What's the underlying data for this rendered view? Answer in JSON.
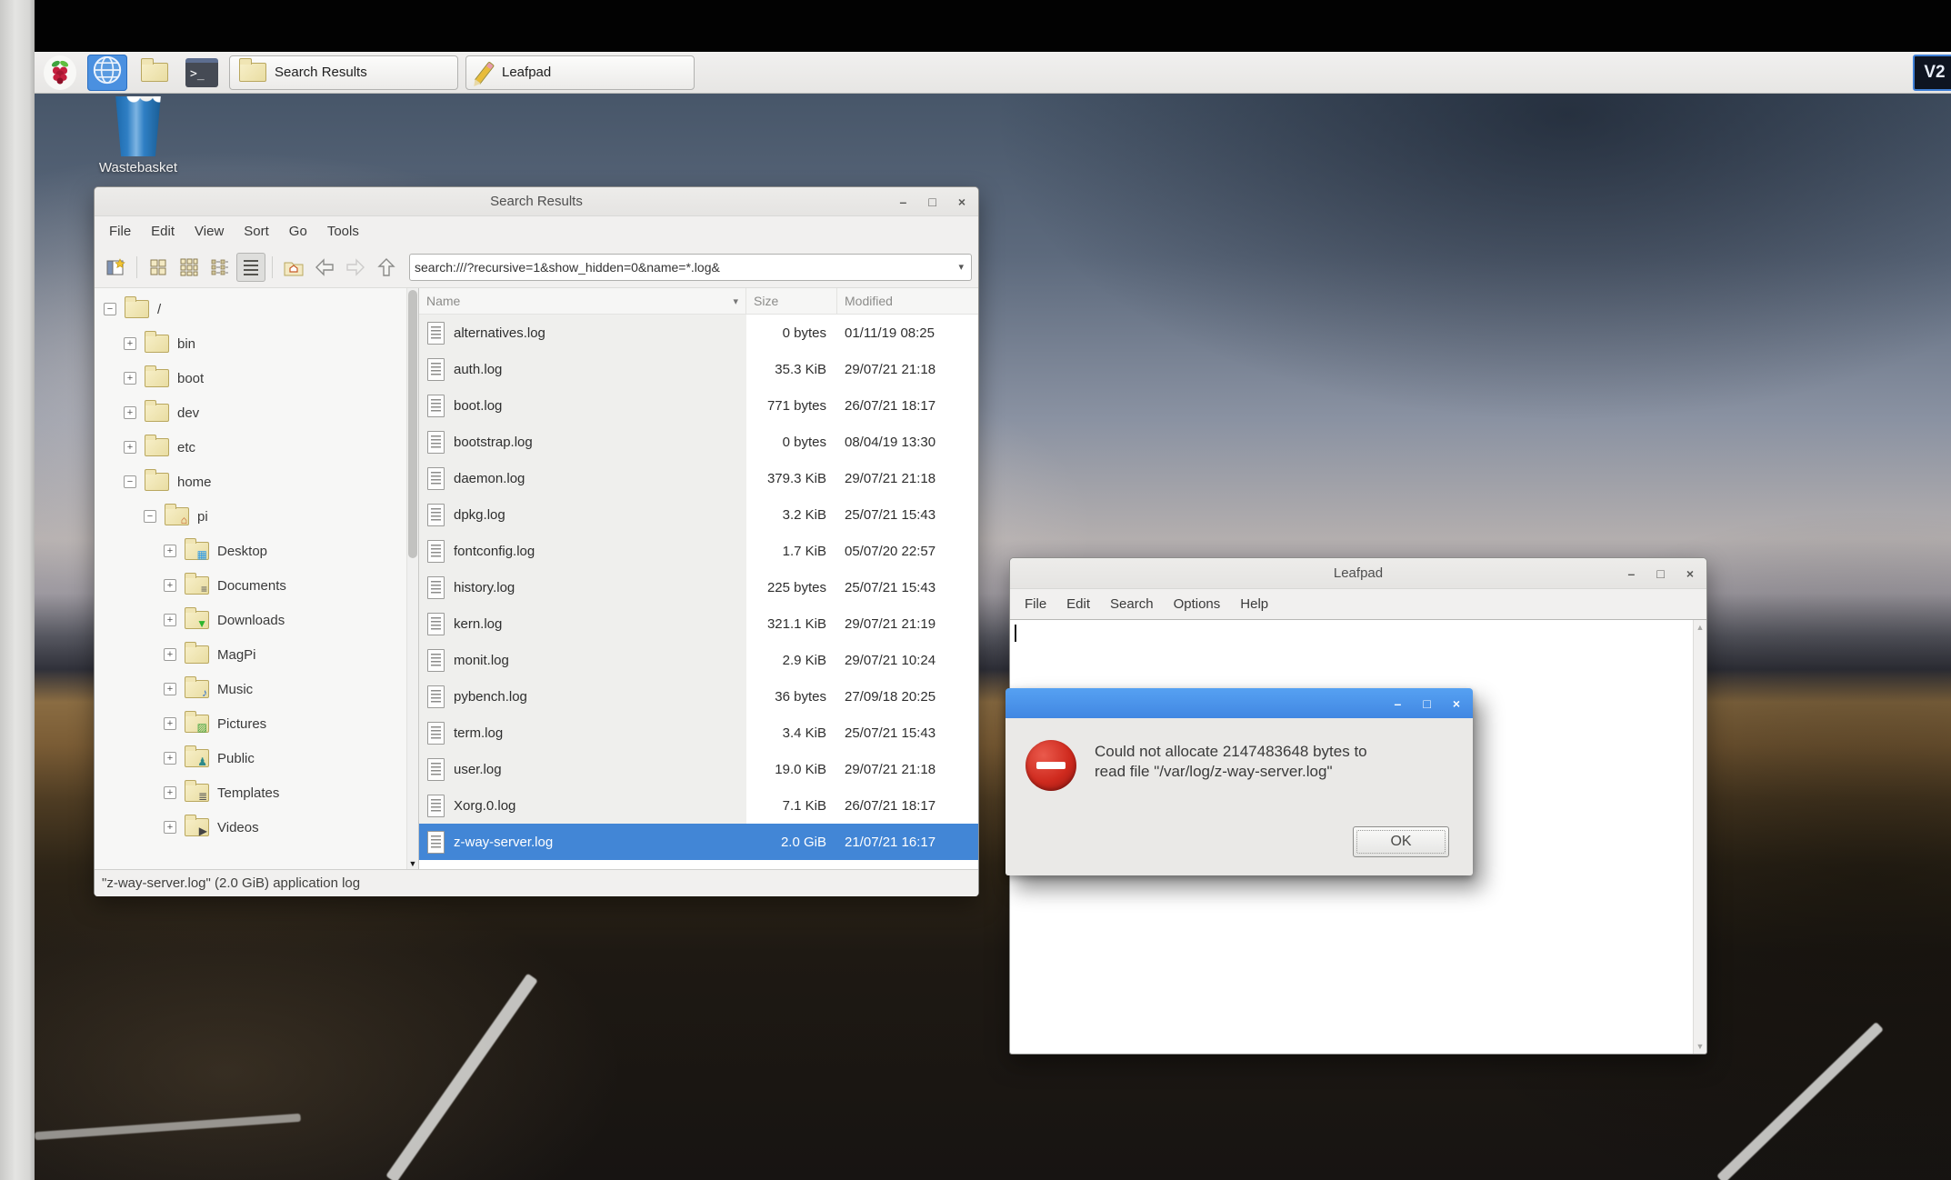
{
  "taskbar": {
    "buttons": [
      {
        "label": "Search Results"
      },
      {
        "label": "Leafpad"
      }
    ],
    "tray_vnc_label": "V2"
  },
  "desktop": {
    "wastebasket_label": "Wastebasket"
  },
  "file_manager": {
    "title": "Search Results",
    "menu": [
      "File",
      "Edit",
      "View",
      "Sort",
      "Go",
      "Tools"
    ],
    "address": "search:///?recursive=1&show_hidden=0&name=*.log&",
    "columns": [
      "Name",
      "Size",
      "Modified"
    ],
    "tree": [
      {
        "label": "/",
        "depth": 0,
        "expander": "-",
        "emblem": ""
      },
      {
        "label": "bin",
        "depth": 1,
        "expander": "+",
        "emblem": ""
      },
      {
        "label": "boot",
        "depth": 1,
        "expander": "+",
        "emblem": ""
      },
      {
        "label": "dev",
        "depth": 1,
        "expander": "+",
        "emblem": ""
      },
      {
        "label": "etc",
        "depth": 1,
        "expander": "+",
        "emblem": ""
      },
      {
        "label": "home",
        "depth": 1,
        "expander": "-",
        "emblem": ""
      },
      {
        "label": "pi",
        "depth": 2,
        "expander": "-",
        "emblem": "home"
      },
      {
        "label": "Desktop",
        "depth": 3,
        "expander": "+",
        "emblem": "desktop"
      },
      {
        "label": "Documents",
        "depth": 3,
        "expander": "+",
        "emblem": "documents"
      },
      {
        "label": "Downloads",
        "depth": 3,
        "expander": "+",
        "emblem": "downloads"
      },
      {
        "label": "MagPi",
        "depth": 3,
        "expander": "+",
        "emblem": ""
      },
      {
        "label": "Music",
        "depth": 3,
        "expander": "+",
        "emblem": "music"
      },
      {
        "label": "Pictures",
        "depth": 3,
        "expander": "+",
        "emblem": "pictures"
      },
      {
        "label": "Public",
        "depth": 3,
        "expander": "+",
        "emblem": "public"
      },
      {
        "label": "Templates",
        "depth": 3,
        "expander": "+",
        "emblem": "templates"
      },
      {
        "label": "Videos",
        "depth": 3,
        "expander": "+",
        "emblem": "videos"
      }
    ],
    "files": [
      {
        "name": "alternatives.log",
        "size": "0 bytes",
        "modified": "01/11/19 08:25",
        "selected": false
      },
      {
        "name": "auth.log",
        "size": "35.3 KiB",
        "modified": "29/07/21 21:18",
        "selected": false
      },
      {
        "name": "boot.log",
        "size": "771 bytes",
        "modified": "26/07/21 18:17",
        "selected": false
      },
      {
        "name": "bootstrap.log",
        "size": "0 bytes",
        "modified": "08/04/19 13:30",
        "selected": false
      },
      {
        "name": "daemon.log",
        "size": "379.3 KiB",
        "modified": "29/07/21 21:18",
        "selected": false
      },
      {
        "name": "dpkg.log",
        "size": "3.2 KiB",
        "modified": "25/07/21 15:43",
        "selected": false
      },
      {
        "name": "fontconfig.log",
        "size": "1.7 KiB",
        "modified": "05/07/20 22:57",
        "selected": false
      },
      {
        "name": "history.log",
        "size": "225 bytes",
        "modified": "25/07/21 15:43",
        "selected": false
      },
      {
        "name": "kern.log",
        "size": "321.1 KiB",
        "modified": "29/07/21 21:19",
        "selected": false
      },
      {
        "name": "monit.log",
        "size": "2.9 KiB",
        "modified": "29/07/21 10:24",
        "selected": false
      },
      {
        "name": "pybench.log",
        "size": "36 bytes",
        "modified": "27/09/18 20:25",
        "selected": false
      },
      {
        "name": "term.log",
        "size": "3.4 KiB",
        "modified": "25/07/21 15:43",
        "selected": false
      },
      {
        "name": "user.log",
        "size": "19.0 KiB",
        "modified": "29/07/21 21:18",
        "selected": false
      },
      {
        "name": "Xorg.0.log",
        "size": "7.1 KiB",
        "modified": "26/07/21 18:17",
        "selected": false
      },
      {
        "name": "z-way-server.log",
        "size": "2.0 GiB",
        "modified": "21/07/21 16:17",
        "selected": true
      }
    ],
    "status": "\"z-way-server.log\" (2.0 GiB) application log"
  },
  "leafpad": {
    "title": "Leafpad",
    "menu": [
      "File",
      "Edit",
      "Search",
      "Options",
      "Help"
    ]
  },
  "dialog": {
    "message": "Could not allocate 2147483648 bytes to read file \"/var/log/z-way-server.log\"",
    "ok_label": "OK"
  },
  "icons": {
    "minimize": "–",
    "maximize": "□",
    "close": "×",
    "sort_chevron": "▾",
    "dropdown_chevron": "▾",
    "scroll_up": "▲",
    "scroll_down": "▼",
    "tree_scroll_down": "▼"
  },
  "colors": {
    "selection_blue": "#4286d6",
    "dialog_titlebar_blue": "#4187e2",
    "error_red": "#cf2a1e"
  }
}
